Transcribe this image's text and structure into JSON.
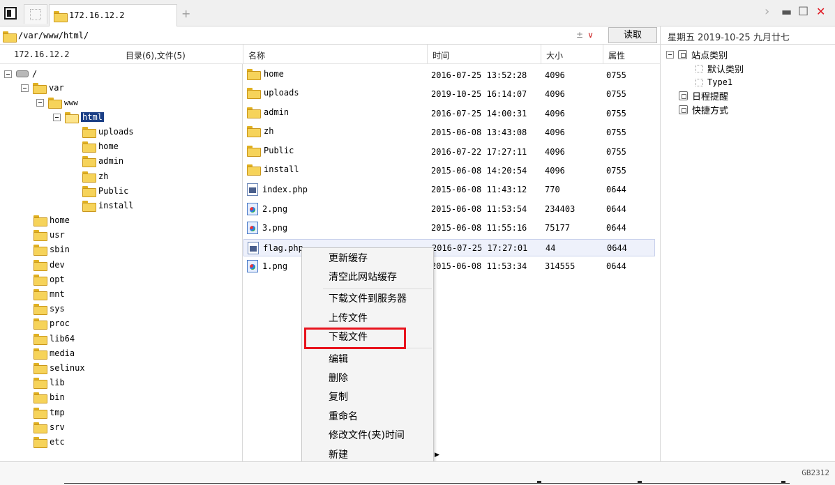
{
  "tab": {
    "title": "172.16.12.2"
  },
  "address": {
    "path": "/var/www/html/",
    "tools": "±",
    "read_label": "读取"
  },
  "datebar": {
    "text": "星期五 2019-10-25 九月廿七"
  },
  "header": {
    "host": "172.16.12.2",
    "summary": "目录(6),文件(5)",
    "col_name": "名称",
    "col_time": "时间",
    "col_size": "大小",
    "col_attr": "属性"
  },
  "tree": {
    "root": "/",
    "var": "var",
    "www": "www",
    "html": "html",
    "html_children": [
      "uploads",
      "home",
      "admin",
      "zh",
      "Public",
      "install"
    ],
    "top_level": [
      "home",
      "usr",
      "sbin",
      "dev",
      "opt",
      "mnt",
      "sys",
      "proc",
      "lib64",
      "media",
      "selinux",
      "lib",
      "bin",
      "tmp",
      "srv",
      "etc"
    ]
  },
  "files": [
    {
      "name": "home",
      "time": "2016-07-25 13:52:28",
      "size": "4096",
      "attr": "0755",
      "type": "folder"
    },
    {
      "name": "uploads",
      "time": "2019-10-25 16:14:07",
      "size": "4096",
      "attr": "0755",
      "type": "folder"
    },
    {
      "name": "admin",
      "time": "2016-07-25 14:00:31",
      "size": "4096",
      "attr": "0755",
      "type": "folder"
    },
    {
      "name": "zh",
      "time": "2015-06-08 13:43:08",
      "size": "4096",
      "attr": "0755",
      "type": "folder"
    },
    {
      "name": "Public",
      "time": "2016-07-22 17:27:11",
      "size": "4096",
      "attr": "0755",
      "type": "folder"
    },
    {
      "name": "install",
      "time": "2015-06-08 14:20:54",
      "size": "4096",
      "attr": "0755",
      "type": "folder"
    },
    {
      "name": "index.php",
      "time": "2015-06-08 11:43:12",
      "size": "770",
      "attr": "0644",
      "type": "php"
    },
    {
      "name": "2.png",
      "time": "2015-06-08 11:53:54",
      "size": "234403",
      "attr": "0644",
      "type": "png"
    },
    {
      "name": "3.png",
      "time": "2015-06-08 11:55:16",
      "size": "75177",
      "attr": "0644",
      "type": "png"
    },
    {
      "name": "flag.php",
      "time": "2016-07-25 17:27:01",
      "size": "44",
      "attr": "0644",
      "type": "php"
    },
    {
      "name": "1.png",
      "time": "2015-06-08 11:53:34",
      "size": "314555",
      "attr": "0644",
      "type": "png"
    }
  ],
  "side": {
    "site_category": "站点类别",
    "default_category": "默认类别",
    "type1": "Type1",
    "schedule": "日程提醒",
    "shortcut": "快捷方式"
  },
  "context_menu": [
    "更新缓存",
    "清空此网站缓存",
    "下载文件到服务器",
    "上传文件",
    "下载文件",
    "编辑",
    "删除",
    "复制",
    "重命名",
    "修改文件(夹)时间",
    "新建"
  ],
  "status": {
    "encoding": "GB2312"
  },
  "colors": {
    "selection": "#1b3f86",
    "highlight_box": "#e8131d",
    "row_highlight": "#eef1fb"
  }
}
